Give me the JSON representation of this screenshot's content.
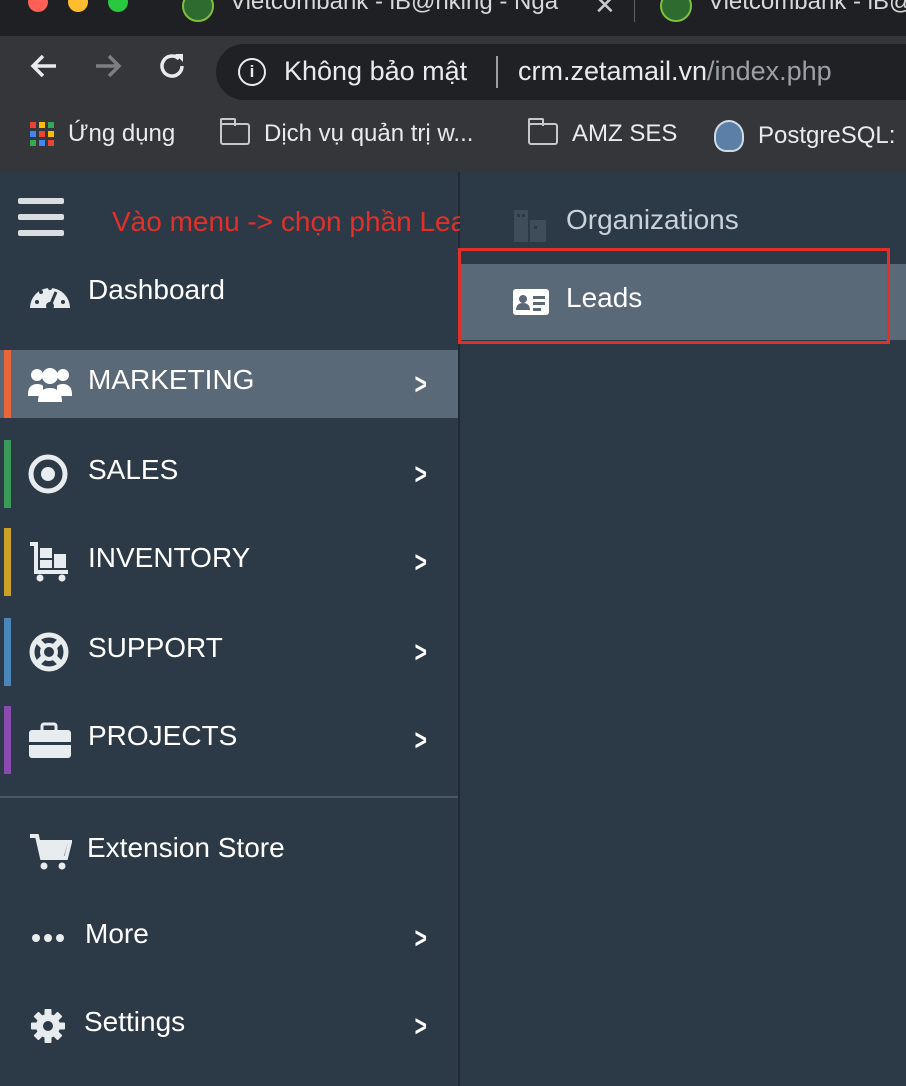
{
  "browser": {
    "tabs": [
      {
        "title": "Vietcombank - iB@nking - Ngâ"
      },
      {
        "title": "Vietcombank - iB@"
      }
    ],
    "address": {
      "security_label": "Không bảo mật",
      "url_host": "crm.zetamail.vn",
      "url_path": "/index.php"
    },
    "bookmarks": [
      {
        "label": "Ứng dụng",
        "icon": "apps-grid-icon"
      },
      {
        "label": "Dịch vụ quản trị w...",
        "icon": "folder-icon"
      },
      {
        "label": "AMZ SES",
        "icon": "folder-icon"
      },
      {
        "label": "PostgreSQL:",
        "icon": "postgresql-icon"
      }
    ]
  },
  "annotation": "Vào menu -> chọn phần Leads",
  "sidebar": {
    "items": [
      {
        "label": "Dashboard",
        "icon": "dashboard-gauge-icon",
        "accent": ""
      },
      {
        "label": "MARKETING",
        "icon": "users-group-icon",
        "accent": "#e8663a",
        "active": true
      },
      {
        "label": "SALES",
        "icon": "target-icon",
        "accent": "#3a9a5a"
      },
      {
        "label": "INVENTORY",
        "icon": "cart-boxes-icon",
        "accent": "#c9a227"
      },
      {
        "label": "SUPPORT",
        "icon": "lifebuoy-icon",
        "accent": "#4a86b8"
      },
      {
        "label": "PROJECTS",
        "icon": "briefcase-icon",
        "accent": "#8a4ab0"
      }
    ],
    "bottom": [
      {
        "label": "Extension Store",
        "icon": "shopping-cart-icon"
      },
      {
        "label": "More",
        "icon": "ellipsis-icon"
      },
      {
        "label": "Settings",
        "icon": "gear-icon"
      }
    ]
  },
  "submenu": {
    "items": [
      {
        "label": "Organizations",
        "icon": "building-icon"
      },
      {
        "label": "Leads",
        "icon": "id-card-icon",
        "highlighted": true
      }
    ]
  },
  "colors": {
    "sidebar_bg": "#2c3a47",
    "active_bg": "#5a6977",
    "annotation_red": "#e0302a"
  }
}
